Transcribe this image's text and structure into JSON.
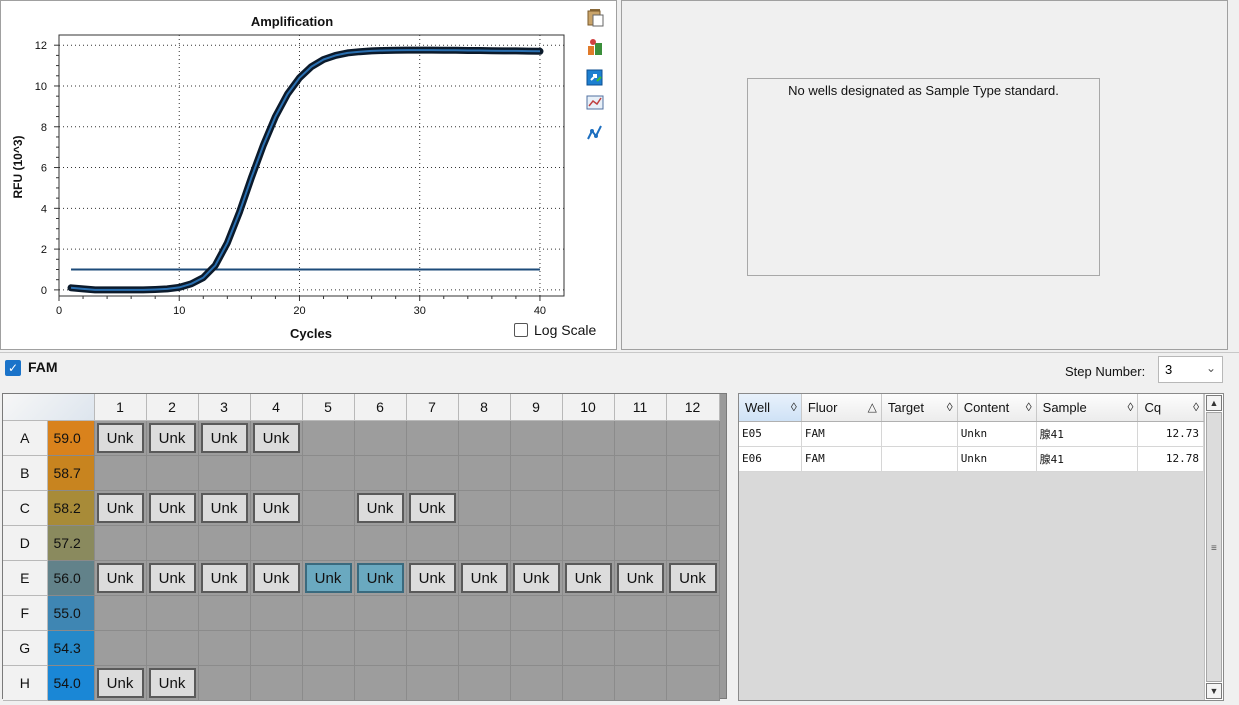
{
  "chart": {
    "title": "Amplification",
    "xlabel": "Cycles",
    "ylabel": "RFU (10^3)",
    "log_scale_label": "Log Scale",
    "log_scale_checked": false,
    "toolbar_icons": [
      "copy-icon",
      "export-icon",
      "open-icon",
      "chart-settings-icon",
      "trace-styles-icon"
    ]
  },
  "chart_data": {
    "type": "line",
    "title": "Amplification",
    "xlabel": "Cycles",
    "ylabel": "RFU (10^3)",
    "xlim": [
      0,
      42
    ],
    "ylim": [
      -0.3,
      12.5
    ],
    "xticks": [
      0,
      10,
      20,
      30,
      40
    ],
    "yticks": [
      0,
      2,
      4,
      6,
      8,
      10,
      12
    ],
    "grid": true,
    "series": [
      {
        "x": [
          1,
          2,
          3,
          4,
          5,
          6,
          7,
          8,
          9,
          10,
          11,
          12,
          13,
          14,
          15,
          16,
          17,
          18,
          19,
          20,
          21,
          22,
          23,
          24,
          25,
          26,
          27,
          28,
          29,
          30,
          31,
          32,
          33,
          34,
          35,
          36,
          37,
          38,
          39,
          40
        ],
        "y": [
          0.1,
          0.05,
          0.0,
          0.0,
          0.0,
          0.0,
          0.0,
          0.02,
          0.05,
          0.12,
          0.3,
          0.6,
          1.2,
          2.3,
          3.8,
          5.5,
          7.1,
          8.5,
          9.6,
          10.4,
          10.95,
          11.3,
          11.5,
          11.62,
          11.68,
          11.72,
          11.74,
          11.75,
          11.76,
          11.76,
          11.76,
          11.75,
          11.75,
          11.74,
          11.74,
          11.73,
          11.72,
          11.72,
          11.71,
          11.7
        ]
      }
    ],
    "threshold": 1.0,
    "threshold_xrange": [
      1,
      40
    ]
  },
  "standard_curve": {
    "message": "No wells designated as Sample Type standard."
  },
  "fluor_bar": {
    "fluor_label": "FAM",
    "fluor_checked": true,
    "step_label": "Step Number:",
    "step_value": "3"
  },
  "plate": {
    "columns": [
      "1",
      "2",
      "3",
      "4",
      "5",
      "6",
      "7",
      "8",
      "9",
      "10",
      "11",
      "12"
    ],
    "rows": [
      {
        "label": "A",
        "temp": "59.0",
        "temp_color": "#d9821c",
        "wells": [
          "Unk",
          "Unk",
          "Unk",
          "Unk",
          "",
          "",
          "",
          "",
          "",
          "",
          "",
          ""
        ]
      },
      {
        "label": "B",
        "temp": "58.7",
        "temp_color": "#c8841f",
        "wells": [
          "",
          "",
          "",
          "",
          "",
          "",
          "",
          "",
          "",
          "",
          "",
          ""
        ]
      },
      {
        "label": "C",
        "temp": "58.2",
        "temp_color": "#a88b38",
        "wells": [
          "Unk",
          "Unk",
          "Unk",
          "Unk",
          "",
          "Unk",
          "Unk",
          "",
          "",
          "",
          "",
          ""
        ]
      },
      {
        "label": "D",
        "temp": "57.2",
        "temp_color": "#8a8a5e",
        "wells": [
          "",
          "",
          "",
          "",
          "",
          "",
          "",
          "",
          "",
          "",
          "",
          ""
        ]
      },
      {
        "label": "E",
        "temp": "56.0",
        "temp_color": "#62828a",
        "wells": [
          "Unk",
          "Unk",
          "Unk",
          "Unk",
          "Unk",
          "Unk",
          "Unk",
          "Unk",
          "Unk",
          "Unk",
          "Unk",
          "Unk"
        ],
        "selected": [
          4,
          5
        ]
      },
      {
        "label": "F",
        "temp": "55.0",
        "temp_color": "#3f86b3",
        "wells": [
          "",
          "",
          "",
          "",
          "",
          "",
          "",
          "",
          "",
          "",
          "",
          ""
        ]
      },
      {
        "label": "G",
        "temp": "54.3",
        "temp_color": "#2589c9",
        "wells": [
          "",
          "",
          "",
          "",
          "",
          "",
          "",
          "",
          "",
          "",
          "",
          ""
        ]
      },
      {
        "label": "H",
        "temp": "54.0",
        "temp_color": "#1a87d6",
        "wells": [
          "Unk",
          "Unk",
          "",
          "",
          "",
          "",
          "",
          "",
          "",
          "",
          "",
          ""
        ]
      }
    ]
  },
  "results": {
    "headers": [
      "Well",
      "Fluor",
      "Target",
      "Content",
      "Sample",
      "Cq"
    ],
    "sort_icons": [
      "◊",
      "△",
      "◊",
      "◊",
      "◊",
      "◊"
    ],
    "rows": [
      [
        "E05",
        "FAM",
        "",
        "Unkn",
        "腺41",
        "12.73"
      ],
      [
        "E06",
        "FAM",
        "",
        "Unkn",
        "腺41",
        "12.78"
      ]
    ]
  }
}
